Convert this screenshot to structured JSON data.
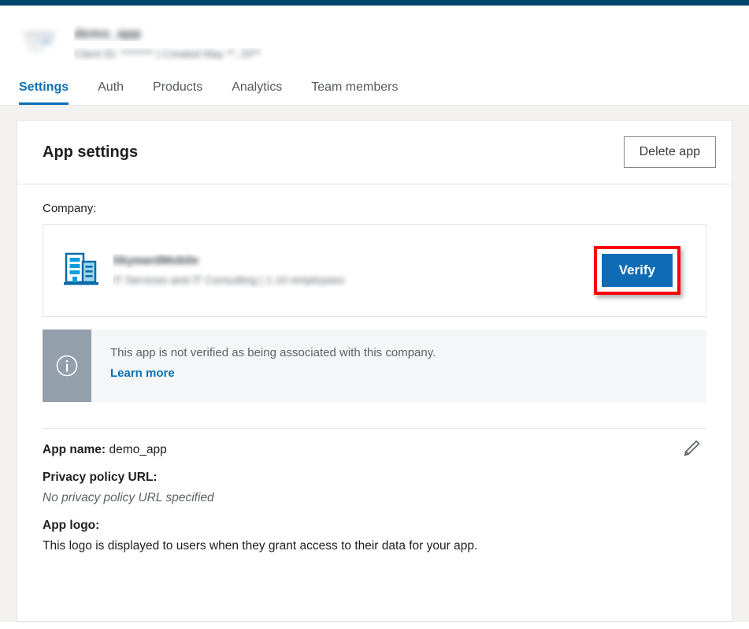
{
  "theme": {
    "top_bar_color": "#00456e",
    "accent_blue": "#0a70b7",
    "verify_button_color": "#0f6cb4",
    "highlight_color": "#ff0000",
    "page_background": "#f3f2f1",
    "info_banner_background": "#f4f6f8",
    "info_icon_background": "#93a0ac"
  },
  "app_header": {
    "logo_alt": "app-logo",
    "title": "demo_app",
    "subtitle": "Client ID: ******** | Created May **, 20**"
  },
  "tabs": [
    {
      "label": "Settings",
      "active": true
    },
    {
      "label": "Auth",
      "active": false
    },
    {
      "label": "Products",
      "active": false
    },
    {
      "label": "Analytics",
      "active": false
    },
    {
      "label": "Team members",
      "active": false
    }
  ],
  "card": {
    "title": "App settings",
    "delete_label": "Delete app"
  },
  "company": {
    "label": "Company:",
    "icon": "building-icon",
    "name": "SkywardMobile",
    "description": "IT Services and IT Consulting | 1-10 employees",
    "verify_label": "Verify"
  },
  "info_banner": {
    "icon": "info-circle-icon",
    "message": "This app is not verified as being associated with this company.",
    "link_label": "Learn more"
  },
  "details": {
    "edit_icon": "pencil-icon",
    "app_name_key": "App name:",
    "app_name_value": "demo_app",
    "privacy_policy_key": "Privacy policy URL:",
    "privacy_policy_value": "No privacy policy URL specified",
    "app_logo_key": "App logo:",
    "app_logo_note": "This logo is displayed to users when they grant access to their data for your app."
  }
}
